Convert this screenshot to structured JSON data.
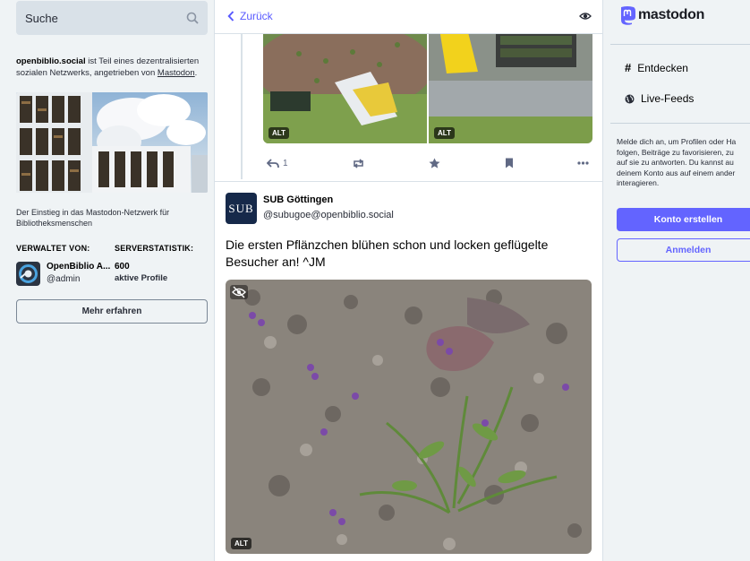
{
  "search": {
    "placeholder": "Suche",
    "icon": "search-icon"
  },
  "about": {
    "server": "openbiblio.social",
    "text": " ist Teil eines dezentralisierten sozialen Netzwerks, angetrieben von ",
    "link": "Mastodon",
    "end": "."
  },
  "tagline": "Der Einstieg in das Mastodon-Netzwerk für Bibliotheksmenschen",
  "admin": {
    "heading": "VERWALTET VON:",
    "name": "OpenBiblio A...",
    "handle": "@admin"
  },
  "stats": {
    "heading": "SERVERSTATISTIK:",
    "number": "600",
    "label": "aktive Profile"
  },
  "more_button": "Mehr erfahren",
  "column": {
    "back_label": "Zurück"
  },
  "prev_post": {
    "alt_labels": [
      "ALT",
      "ALT"
    ],
    "reply_count": "1"
  },
  "post": {
    "avatar_text": "SUB",
    "display_name": "SUB Göttingen",
    "account": "@subugoe@openbiblio.social",
    "text": "Die ersten Pflänzchen blühen schon und locken geflügelte Besucher an! ^JM",
    "alt_label": "ALT"
  },
  "sidebar": {
    "logo": "mastodon",
    "nav": [
      {
        "label": "Entdecken",
        "icon": "hashtag-icon"
      },
      {
        "label": "Live-Feeds",
        "icon": "globe-icon"
      }
    ],
    "signup_lines": [
      "Melde dich an, um Profilen oder Ha",
      "folgen, Beiträge zu favorisieren, zu",
      "auf sie zu antworten. Du kannst au",
      "deinem Konto aus auf einem ander",
      "interagieren."
    ],
    "create_button": "Konto erstellen",
    "login_button": "Anmelden"
  },
  "colors": {
    "accent": "#6364ff",
    "link": "#595aff",
    "background": "#eff3f5"
  }
}
